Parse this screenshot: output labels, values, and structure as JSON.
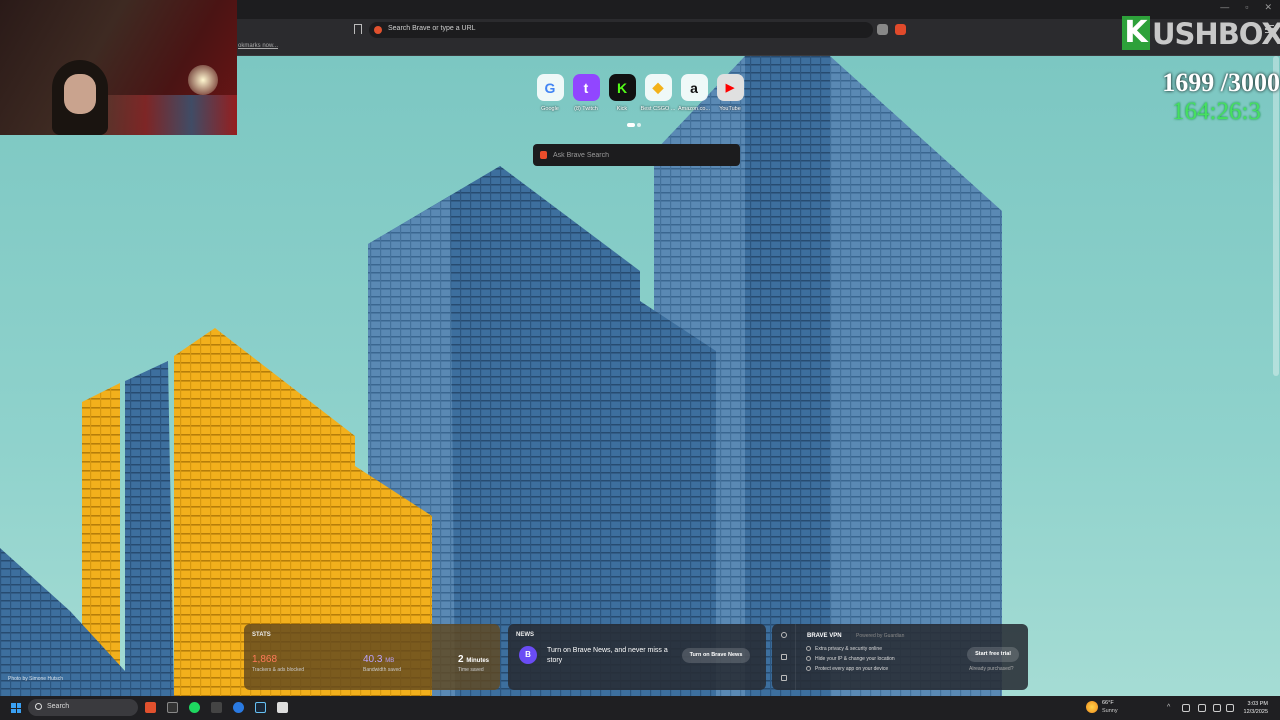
{
  "browser": {
    "url_placeholder": "Search Brave or type a URL",
    "bookmarks_note": "okmarks now..."
  },
  "overlay": {
    "brand_letter": "K",
    "brand_name": "USHBOX",
    "counter": "1699 /3000",
    "timer": "164:26:3"
  },
  "top_sites": [
    {
      "label": "Google",
      "glyph": "G",
      "color": "#4285f4"
    },
    {
      "label": "(8) Twitch",
      "glyph": "t",
      "color": "#9146ff"
    },
    {
      "label": "Kick",
      "glyph": "K",
      "color": "#53fc18"
    },
    {
      "label": "Best CSGO ...",
      "glyph": "◆",
      "color": "#f3b21a"
    },
    {
      "label": "Amazon.co...",
      "glyph": "a",
      "color": "#111111"
    },
    {
      "label": "YouTube",
      "glyph": "▶",
      "color": "#ff0000"
    }
  ],
  "search": {
    "placeholder": "Ask Brave Search"
  },
  "photo_credit": "Photo by Simone Hutsch",
  "stats": {
    "title": "STATS",
    "trackers_value": "1,868",
    "trackers_label": "Trackers & ads blocked",
    "bandwidth_value": "40.3",
    "bandwidth_unit": "MB",
    "bandwidth_label": "Bandwidth saved",
    "time_value": "2",
    "time_unit": "Minutes",
    "time_label": "Time saved"
  },
  "news": {
    "title": "NEWS",
    "avatar": "B",
    "text": "Turn on Brave News, and never miss a story",
    "button": "Turn on Brave News"
  },
  "vpn": {
    "title": "BRAVE VPN",
    "powered": "Powered by  Guardian",
    "features": [
      "Extra privacy & security online",
      "Hide your IP & change your location",
      "Protect every app on your device"
    ],
    "cta": "Start free trial",
    "already": "Already purchased?"
  },
  "taskbar": {
    "search_label": "Search",
    "weather_temp": "66°F",
    "weather_cond": "Sunny",
    "time": "3:03 PM",
    "date": "12/3/2025"
  },
  "colors": {
    "trackers": "#ff7a5a",
    "bandwidth": "#b9a2ff",
    "time": "#ffffff"
  }
}
